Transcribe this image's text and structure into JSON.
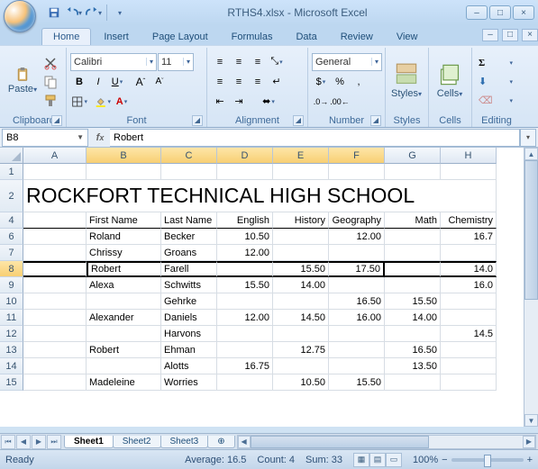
{
  "title": "RTHS4.xlsx - Microsoft Excel",
  "tabs": [
    "Home",
    "Insert",
    "Page Layout",
    "Formulas",
    "Data",
    "Review",
    "View"
  ],
  "active_tab": 0,
  "ribbon": {
    "clipboard": {
      "paste": "Paste",
      "label": "Clipboard"
    },
    "font": {
      "name": "Calibri",
      "size": "11",
      "label": "Font"
    },
    "alignment": {
      "label": "Alignment"
    },
    "number": {
      "format": "General",
      "label": "Number"
    },
    "styles": {
      "label": "Styles",
      "btn": "Styles"
    },
    "cells": {
      "label": "Cells",
      "btn": "Cells"
    },
    "editing": {
      "label": "Editing"
    }
  },
  "namebox": "B8",
  "formula": "Robert",
  "cols": [
    "A",
    "B",
    "C",
    "D",
    "E",
    "F",
    "G",
    "H"
  ],
  "sel_cols": [
    "B",
    "C",
    "D",
    "E",
    "F"
  ],
  "rows": [
    {
      "n": 1,
      "h": 18,
      "cells": [
        "",
        "",
        "",
        "",
        "",
        "",
        "",
        ""
      ]
    },
    {
      "n": 2,
      "h": 36,
      "title": "ROCKFORT TECHNICAL HIGH SCHOOL"
    },
    {
      "n": 4,
      "h": 18,
      "hdr": true,
      "cells": [
        "",
        "First Name",
        "Last Name",
        "English",
        "History",
        "Geography",
        "Math",
        "Chemistry"
      ]
    },
    {
      "n": 6,
      "h": 18,
      "cells": [
        "",
        "Roland",
        "Becker",
        "10.50",
        "",
        "12.00",
        "",
        "16.7"
      ]
    },
    {
      "n": 7,
      "h": 18,
      "cells": [
        "",
        "Chrissy",
        "Groans",
        "12.00",
        "",
        "",
        "",
        ""
      ]
    },
    {
      "n": 8,
      "h": 18,
      "sel": true,
      "cells": [
        "",
        "Robert",
        "Farell",
        "",
        "15.50",
        "17.50",
        "",
        "14.0"
      ]
    },
    {
      "n": 9,
      "h": 18,
      "cells": [
        "",
        "Alexa",
        "Schwitts",
        "15.50",
        "14.00",
        "",
        "",
        "16.0"
      ]
    },
    {
      "n": 10,
      "h": 18,
      "cells": [
        "",
        "",
        "Gehrke",
        "",
        "",
        "16.50",
        "15.50",
        ""
      ]
    },
    {
      "n": 11,
      "h": 18,
      "cells": [
        "",
        "Alexander",
        "Daniels",
        "12.00",
        "14.50",
        "16.00",
        "14.00",
        ""
      ]
    },
    {
      "n": 12,
      "h": 18,
      "cells": [
        "",
        "",
        "Harvons",
        "",
        "",
        "",
        "",
        "14.5"
      ]
    },
    {
      "n": 13,
      "h": 18,
      "cells": [
        "",
        "Robert",
        "Ehman",
        "",
        "12.75",
        "",
        "16.50",
        ""
      ]
    },
    {
      "n": 14,
      "h": 18,
      "cells": [
        "",
        "",
        "Alotts",
        "16.75",
        "",
        "",
        "13.50",
        ""
      ]
    },
    {
      "n": 15,
      "h": 18,
      "cells": [
        "",
        "Madeleine",
        "Worries",
        "",
        "10.50",
        "15.50",
        "",
        ""
      ]
    }
  ],
  "num_cols": [
    3,
    4,
    5,
    6,
    7
  ],
  "sheets": [
    "Sheet1",
    "Sheet2",
    "Sheet3"
  ],
  "active_sheet": 0,
  "status": {
    "state": "Ready",
    "avg": "Average: 16.5",
    "count": "Count: 4",
    "sum": "Sum: 33",
    "zoom": "100%"
  }
}
